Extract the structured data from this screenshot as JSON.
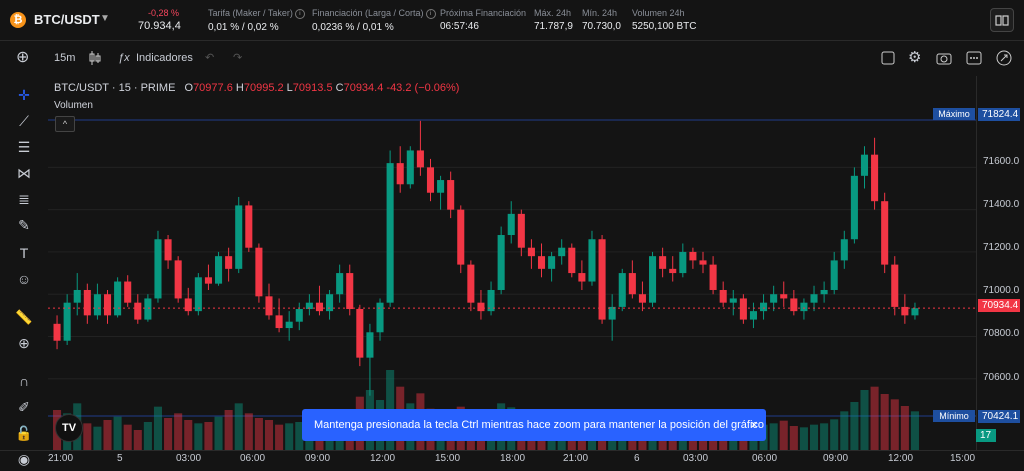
{
  "header": {
    "pair": "BTC/USDT",
    "change": "-0,28 %",
    "price": "70.934,4",
    "stats": [
      {
        "label": "Tarifa (Maker / Taker)",
        "value": "0,01 % / 0,02 %"
      },
      {
        "label": "Financiación (Larga / Corta)",
        "value": "0,0236 % / 0,01 %"
      },
      {
        "label": "Próxima Financiación",
        "value": "06:57:46"
      },
      {
        "label": "Máx. 24h",
        "value": "71.787,9"
      },
      {
        "label": "Mín. 24h",
        "value": "70.730,0"
      },
      {
        "label": "Volumen 24h",
        "value": "5250,100 BTC"
      }
    ]
  },
  "toolbar": {
    "interval": "15m",
    "indicators": "Indicadores"
  },
  "legend": {
    "symbol": "BTC/USDT · 15 · PRIME",
    "o_label": "O",
    "o": "70977.6",
    "h_label": "H",
    "h": "70995.2",
    "l_label": "L",
    "l": "70913.5",
    "c_label": "C",
    "c": "70934.4",
    "delta": "-43.2 (−0.06%)",
    "volume_label": "Volumen",
    "collapse": "^"
  },
  "markers": {
    "max_label": "Máximo",
    "min_label": "Mínimo"
  },
  "yaxis": {
    "ticks": [
      "71600.0",
      "71400.0",
      "71200.0",
      "71000.0",
      "70800.0",
      "70600.0"
    ],
    "max_badge": "71824.4",
    "last_badge": "70934.4",
    "min_badge": "70424.1",
    "volume_badge": "17",
    "colors": {
      "max": "#1e4fa0",
      "last": "#f23645",
      "volume": "#089981"
    }
  },
  "xaxis": {
    "ticks": [
      "21:00",
      "5",
      "03:00",
      "06:00",
      "09:00",
      "12:00",
      "15:00",
      "18:00",
      "21:00",
      "6",
      "03:00",
      "06:00",
      "09:00",
      "12:00",
      "15:00"
    ]
  },
  "toast": {
    "message": "Mantenga presionada la tecla Ctrl mientras hace zoom para mantener la posición del gráfico",
    "close": "×"
  },
  "logo": "TV",
  "colors": {
    "up": "#089981",
    "down": "#f23645",
    "background": "#141414",
    "accent": "#2962ff"
  },
  "chart_data": {
    "type": "candlestick",
    "ylim": [
      70424,
      71824
    ],
    "candles": [
      [
        70860,
        70900,
        70740,
        70780
      ],
      [
        70780,
        71000,
        70760,
        70960
      ],
      [
        70960,
        71100,
        70900,
        71020
      ],
      [
        71020,
        71050,
        70860,
        70900
      ],
      [
        70900,
        71050,
        70880,
        71000
      ],
      [
        71000,
        71020,
        70860,
        70900
      ],
      [
        70900,
        71080,
        70890,
        71060
      ],
      [
        71060,
        71090,
        70940,
        70960
      ],
      [
        70960,
        71000,
        70860,
        70880
      ],
      [
        70880,
        71000,
        70870,
        70980
      ],
      [
        70980,
        71300,
        70960,
        71260
      ],
      [
        71260,
        71280,
        71120,
        71160
      ],
      [
        71160,
        71180,
        70960,
        70980
      ],
      [
        70980,
        71030,
        70900,
        70920
      ],
      [
        70920,
        71100,
        70900,
        71080
      ],
      [
        71080,
        71140,
        71020,
        71050
      ],
      [
        71050,
        71200,
        71040,
        71180
      ],
      [
        71180,
        71220,
        71060,
        71120
      ],
      [
        71120,
        71460,
        71100,
        71420
      ],
      [
        71420,
        71440,
        71200,
        71220
      ],
      [
        71220,
        71240,
        70960,
        70990
      ],
      [
        70990,
        71050,
        70880,
        70900
      ],
      [
        70900,
        70980,
        70820,
        70840
      ],
      [
        70840,
        70920,
        70780,
        70870
      ],
      [
        70870,
        70960,
        70830,
        70930
      ],
      [
        70930,
        71000,
        70900,
        70960
      ],
      [
        70960,
        71040,
        70900,
        70920
      ],
      [
        70920,
        71020,
        70880,
        71000
      ],
      [
        71000,
        71140,
        70960,
        71100
      ],
      [
        71100,
        71140,
        70900,
        70930
      ],
      [
        70930,
        70950,
        70660,
        70700
      ],
      [
        70700,
        70860,
        70520,
        70820
      ],
      [
        70820,
        70980,
        70780,
        70960
      ],
      [
        70960,
        71680,
        70940,
        71620
      ],
      [
        71620,
        71700,
        71480,
        71520
      ],
      [
        71520,
        71700,
        71500,
        71680
      ],
      [
        71680,
        71820,
        71560,
        71600
      ],
      [
        71600,
        71640,
        71440,
        71480
      ],
      [
        71480,
        71560,
        71400,
        71540
      ],
      [
        71540,
        71580,
        71360,
        71400
      ],
      [
        71400,
        71420,
        71100,
        71140
      ],
      [
        71140,
        71160,
        70920,
        70960
      ],
      [
        70960,
        71020,
        70880,
        70920
      ],
      [
        70920,
        71060,
        70900,
        71020
      ],
      [
        71020,
        71320,
        71000,
        71280
      ],
      [
        71280,
        71440,
        71240,
        71380
      ],
      [
        71380,
        71400,
        71180,
        71220
      ],
      [
        71220,
        71260,
        71120,
        71180
      ],
      [
        71180,
        71240,
        71080,
        71120
      ],
      [
        71120,
        71200,
        71060,
        71180
      ],
      [
        71180,
        71260,
        71140,
        71220
      ],
      [
        71220,
        71240,
        71080,
        71100
      ],
      [
        71100,
        71160,
        71020,
        71060
      ],
      [
        71060,
        71300,
        71040,
        71260
      ],
      [
        71260,
        71280,
        70860,
        70880
      ],
      [
        70880,
        71000,
        70780,
        70940
      ],
      [
        70940,
        71120,
        70920,
        71100
      ],
      [
        71100,
        71160,
        70980,
        71000
      ],
      [
        71000,
        71060,
        70920,
        70960
      ],
      [
        70960,
        71200,
        70940,
        71180
      ],
      [
        71180,
        71220,
        71080,
        71120
      ],
      [
        71120,
        71180,
        71060,
        71100
      ],
      [
        71100,
        71240,
        71080,
        71200
      ],
      [
        71200,
        71220,
        71120,
        71160
      ],
      [
        71160,
        71200,
        71100,
        71140
      ],
      [
        71140,
        71180,
        71000,
        71020
      ],
      [
        71020,
        71060,
        70940,
        70960
      ],
      [
        70960,
        71020,
        70900,
        70980
      ],
      [
        70980,
        71000,
        70860,
        70880
      ],
      [
        70880,
        70960,
        70840,
        70920
      ],
      [
        70920,
        71000,
        70880,
        70960
      ],
      [
        70960,
        71040,
        70920,
        71000
      ],
      [
        71000,
        71060,
        70940,
        70980
      ],
      [
        70980,
        71020,
        70900,
        70920
      ],
      [
        70920,
        70980,
        70880,
        70960
      ],
      [
        70960,
        71040,
        70920,
        71000
      ],
      [
        71000,
        71060,
        70960,
        71020
      ],
      [
        71020,
        71200,
        71000,
        71160
      ],
      [
        71160,
        71300,
        71120,
        71260
      ],
      [
        71260,
        71600,
        71240,
        71560
      ],
      [
        71560,
        71700,
        71500,
        71660
      ],
      [
        71660,
        71740,
        71400,
        71440
      ],
      [
        71440,
        71480,
        71100,
        71140
      ],
      [
        71140,
        71180,
        70900,
        70940
      ],
      [
        70940,
        71000,
        70860,
        70900
      ],
      [
        70900,
        70960,
        70880,
        70934
      ]
    ],
    "volumes": [
      60,
      55,
      70,
      40,
      35,
      45,
      50,
      38,
      30,
      42,
      65,
      48,
      55,
      45,
      40,
      42,
      50,
      60,
      70,
      55,
      48,
      45,
      38,
      40,
      42,
      35,
      44,
      46,
      58,
      52,
      80,
      90,
      75,
      120,
      95,
      70,
      85,
      62,
      55,
      58,
      65,
      48,
      40,
      46,
      70,
      64,
      50,
      45,
      42,
      38,
      40,
      44,
      36,
      48,
      52,
      46,
      44,
      40,
      38,
      42,
      36,
      34,
      40,
      38,
      36,
      34,
      38,
      36,
      40,
      42,
      38,
      40,
      44,
      36,
      34,
      38,
      40,
      46,
      58,
      72,
      90,
      95,
      84,
      76,
      66,
      58
    ]
  }
}
